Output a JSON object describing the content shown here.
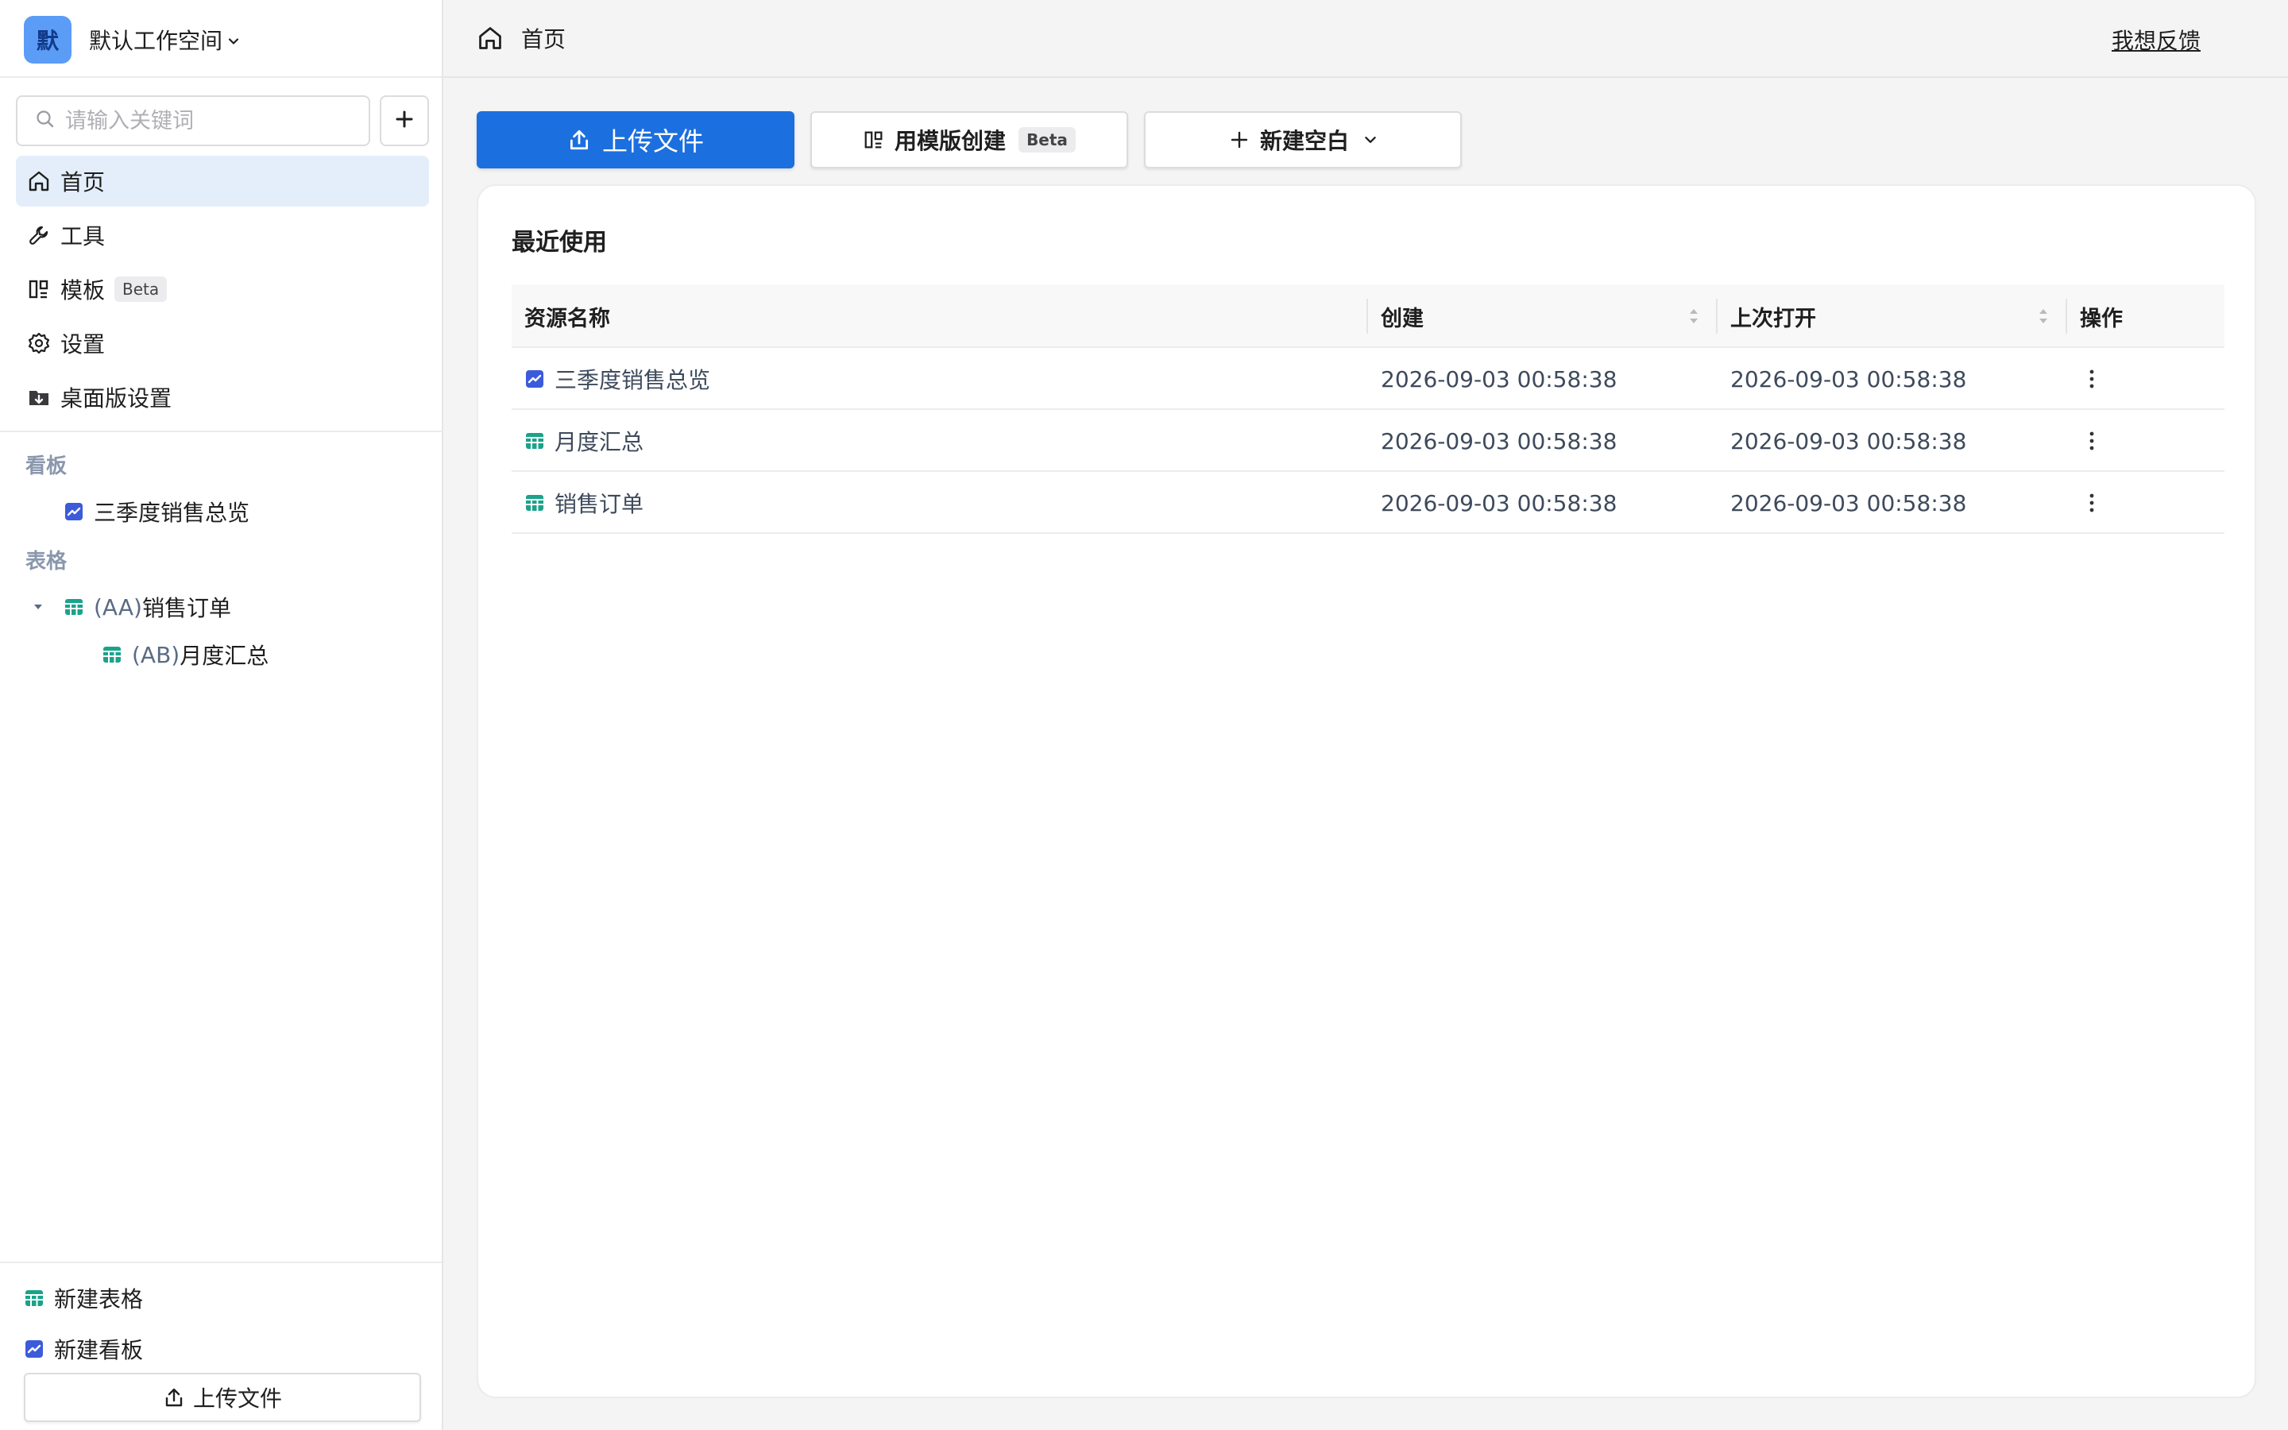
{
  "colors": {
    "accent": "#1c6fde",
    "active_bg": "#e4eefb",
    "section_label": "#8a97ad",
    "table_icon": "#1aa38a",
    "board_icon": "#3b5bdb"
  },
  "workspace": {
    "avatar_char": "默",
    "name": "默认工作空间"
  },
  "search": {
    "placeholder": "请输入关键词",
    "value": ""
  },
  "sidebar": {
    "nav": [
      {
        "label": "首页",
        "icon": "home-icon",
        "active": true
      },
      {
        "label": "工具",
        "icon": "wrench-icon"
      },
      {
        "label": "模板",
        "icon": "template-icon",
        "badge": "Beta"
      },
      {
        "label": "设置",
        "icon": "gear-icon"
      },
      {
        "label": "桌面版设置",
        "icon": "folder-download-icon"
      }
    ],
    "sections": {
      "boards_label": "看板",
      "tables_label": "表格"
    },
    "boards": [
      {
        "label": "三季度销售总览",
        "icon": "board-icon"
      }
    ],
    "tables": [
      {
        "prefix": "(AA)",
        "label": "销售订单",
        "icon": "table-icon",
        "expanded": true
      },
      {
        "prefix": "(AB)",
        "label": "月度汇总",
        "icon": "table-icon",
        "child": true
      }
    ],
    "bottom": {
      "new_table": "新建表格",
      "new_board": "新建看板",
      "upload": "上传文件"
    }
  },
  "topbar": {
    "breadcrumb": "首页",
    "feedback": "我想反馈"
  },
  "actions": {
    "upload": "上传文件",
    "from_template": "用模版创建",
    "from_template_badge": "Beta",
    "new_blank": "新建空白"
  },
  "recent": {
    "title": "最近使用",
    "columns": [
      "资源名称",
      "创建",
      "上次打开",
      "操作"
    ],
    "rows": [
      {
        "name": "三季度销售总览",
        "type": "board",
        "created": "2026-09-03 00:58:38",
        "opened": "2026-09-03 00:58:38"
      },
      {
        "name": "月度汇总",
        "type": "table",
        "created": "2026-09-03 00:58:38",
        "opened": "2026-09-03 00:58:38"
      },
      {
        "name": "销售订单",
        "type": "table",
        "created": "2026-09-03 00:58:38",
        "opened": "2026-09-03 00:58:38"
      }
    ]
  }
}
